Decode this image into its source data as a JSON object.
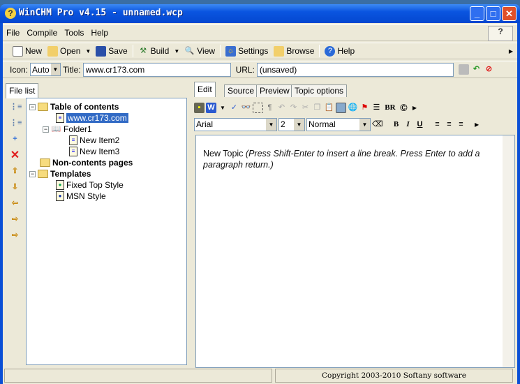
{
  "window": {
    "title": "WinCHM Pro v4.15 - unnamed.wcp"
  },
  "menu": [
    "File",
    "Compile",
    "Tools",
    "Help"
  ],
  "toolbar": {
    "new": "New",
    "open": "Open",
    "save": "Save",
    "build": "Build",
    "view": "View",
    "settings": "Settings",
    "browse": "Browse",
    "help": "Help"
  },
  "topicbar": {
    "icon_label": "Icon:",
    "icon_value": "Auto",
    "title_label": "Title:",
    "title_value": "www.cr173.com",
    "url_label": "URL:",
    "url_value": "(unsaved)"
  },
  "left": {
    "tab": "File list",
    "tree": {
      "toc": "Table of contents",
      "item1": "www.cr173.com",
      "folder": "Folder1",
      "item2": "New Item2",
      "item3": "New Item3",
      "noncontents": "Non-contents pages",
      "templates": "Templates",
      "tpl1": "Fixed Top Style",
      "tpl2": "MSN Style"
    }
  },
  "right": {
    "tabs": [
      "Edit",
      "Source",
      "Preview",
      "Topic options"
    ],
    "font": "Arial",
    "size": "2",
    "style": "Normal",
    "br": "BR",
    "content": {
      "lead": "New Topic ",
      "italic": "(Press Shift-Enter to insert a line break. Press Enter to add a paragraph return.)"
    }
  },
  "status": {
    "copyright": "Copyright 2003-2010 Softany software"
  }
}
